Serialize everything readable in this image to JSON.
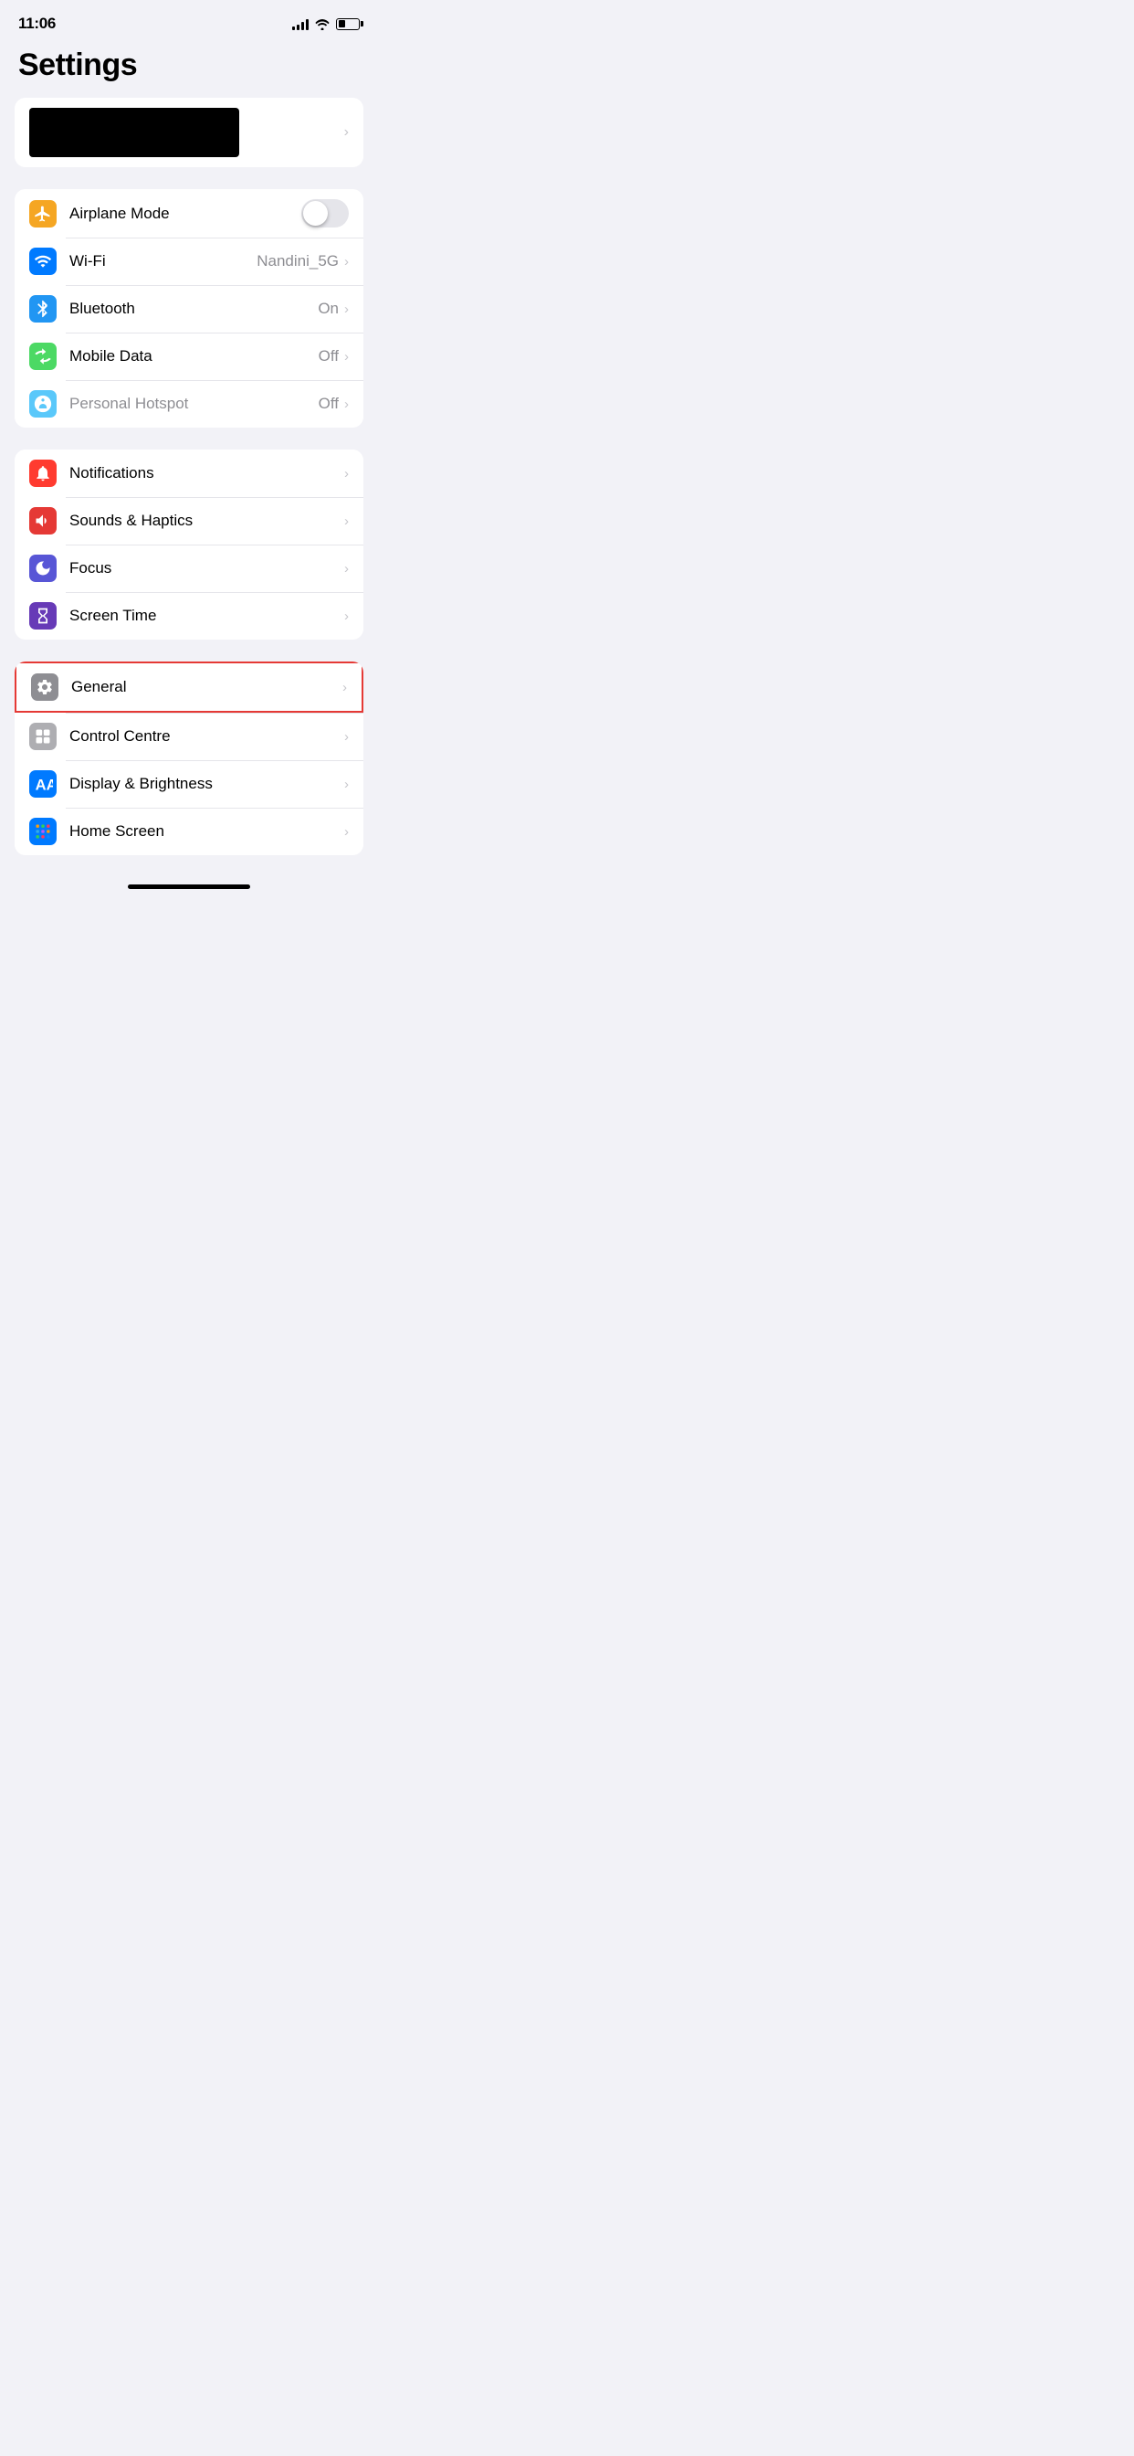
{
  "statusBar": {
    "time": "11:06",
    "battery": 35
  },
  "pageTitle": "Settings",
  "profileSection": {
    "chevron": "›"
  },
  "connectivitySection": {
    "items": [
      {
        "id": "airplane-mode",
        "label": "Airplane Mode",
        "icon": "airplane-icon",
        "iconColor": "icon-orange",
        "hasToggle": true,
        "toggleOn": false,
        "value": "",
        "hasChevron": false
      },
      {
        "id": "wifi",
        "label": "Wi-Fi",
        "icon": "wifi-icon",
        "iconColor": "icon-blue",
        "hasToggle": false,
        "value": "Nandini_5G",
        "hasChevron": true
      },
      {
        "id": "bluetooth",
        "label": "Bluetooth",
        "icon": "bluetooth-icon",
        "iconColor": "icon-blue-dark",
        "hasToggle": false,
        "value": "On",
        "hasChevron": true
      },
      {
        "id": "mobile-data",
        "label": "Mobile Data",
        "icon": "mobile-data-icon",
        "iconColor": "icon-green",
        "hasToggle": false,
        "value": "Off",
        "hasChevron": true
      },
      {
        "id": "personal-hotspot",
        "label": "Personal Hotspot",
        "icon": "hotspot-icon",
        "iconColor": "icon-green",
        "labelDisabled": true,
        "hasToggle": false,
        "value": "Off",
        "hasChevron": true
      }
    ]
  },
  "notificationsSection": {
    "items": [
      {
        "id": "notifications",
        "label": "Notifications",
        "icon": "bell-icon",
        "iconColor": "icon-red",
        "value": "",
        "hasChevron": true
      },
      {
        "id": "sounds-haptics",
        "label": "Sounds & Haptics",
        "icon": "speaker-icon",
        "iconColor": "icon-red-mid",
        "value": "",
        "hasChevron": true
      },
      {
        "id": "focus",
        "label": "Focus",
        "icon": "moon-icon",
        "iconColor": "icon-purple",
        "value": "",
        "hasChevron": true
      },
      {
        "id": "screen-time",
        "label": "Screen Time",
        "icon": "hourglass-icon",
        "iconColor": "icon-purple-dark",
        "value": "",
        "hasChevron": true
      }
    ]
  },
  "systemSection": {
    "items": [
      {
        "id": "general",
        "label": "General",
        "icon": "gear-icon",
        "iconColor": "icon-gray",
        "value": "",
        "hasChevron": true,
        "highlighted": true
      },
      {
        "id": "control-centre",
        "label": "Control Centre",
        "icon": "control-centre-icon",
        "iconColor": "icon-gray-mid",
        "value": "",
        "hasChevron": true
      },
      {
        "id": "display-brightness",
        "label": "Display & Brightness",
        "icon": "display-icon",
        "iconColor": "icon-blue",
        "value": "",
        "hasChevron": true
      },
      {
        "id": "home-screen",
        "label": "Home Screen",
        "icon": "home-screen-icon",
        "iconColor": "icon-blue",
        "value": "",
        "hasChevron": true
      }
    ]
  },
  "chevron": "›"
}
